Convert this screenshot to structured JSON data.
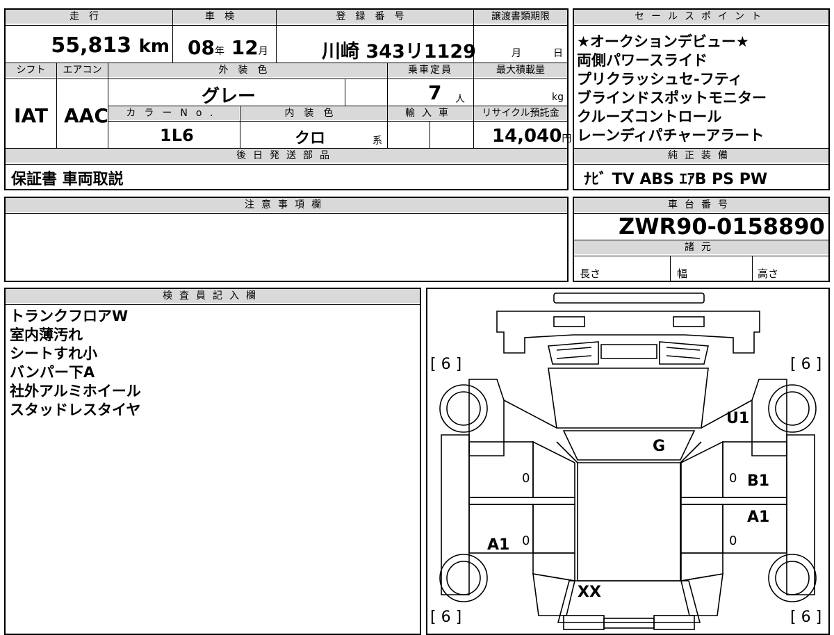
{
  "top_row": {
    "mileage_label": "走行",
    "mileage_value": "55,813",
    "mileage_unit": "km",
    "inspection_label": "車検",
    "inspection_year": "08",
    "inspection_year_unit": "年",
    "inspection_month": "12",
    "inspection_month_unit": "月",
    "registration_label": "登録番号",
    "registration_value": "川崎 343リ1129",
    "transfer_deadline_label": "譲渡書類期限",
    "transfer_month_unit": "月",
    "transfer_day_unit": "日"
  },
  "second_row": {
    "shift_label": "シフト",
    "shift_value": "IAT",
    "aircon_label": "エアコン",
    "aircon_value": "AAC",
    "exterior_color_label": "外装色",
    "exterior_color_value": "グレー",
    "capacity_label": "乗車定員",
    "capacity_value": "7",
    "capacity_unit": "人",
    "max_load_label": "最大積載量",
    "max_load_unit": "kg",
    "color_no_label": "カラーNo.",
    "color_no_value": "1L6",
    "interior_color_label": "内装色",
    "interior_color_value": "クロ",
    "interior_color_suffix": "系",
    "import_label": "輸入車",
    "recycle_label": "リサイクル預託金",
    "recycle_value": "14,040",
    "recycle_unit": "円"
  },
  "later_parts": {
    "label": "後日発送部品",
    "value": "保証書 車両取説"
  },
  "sales_points": {
    "label": "セールスポイント",
    "items": [
      "★オークションデビュー★",
      "両側パワースライド",
      "プリクラッシュセ-フティ",
      "ブラインドスポットモニター",
      "クルーズコントロール",
      "レーンディパチャーアラート"
    ]
  },
  "genuine_equipment": {
    "label": "純正装備",
    "value": "ﾅﾋﾞ TV ABS ｴｱB PS PW"
  },
  "notes": {
    "label": "注意事項欄"
  },
  "chassis": {
    "label": "車台番号",
    "value": "ZWR90-0158890"
  },
  "specs": {
    "label": "諸元",
    "length_label": "長さ",
    "width_label": "幅",
    "height_label": "高さ"
  },
  "inspector": {
    "label": "検査員記入欄",
    "items": [
      "トランクフロアW",
      "室内薄汚れ",
      "シートすれ小",
      "バンパー下A",
      "社外アルミホイール",
      "スタッドレスタイヤ"
    ]
  },
  "diagram": {
    "tire_fl": "[ 6 ]",
    "tire_fr": "[ 6 ]",
    "tire_rl": "[ 6 ]",
    "tire_rr": "[ 6 ]",
    "mark_u1": "U1",
    "mark_g": "G",
    "mark_b1": "B1",
    "mark_a1_right": "A1",
    "mark_a1_left": "A1",
    "mark_xx": "XX",
    "zero_1": "0",
    "zero_2": "0",
    "zero_3": "0",
    "zero_4": "0"
  }
}
